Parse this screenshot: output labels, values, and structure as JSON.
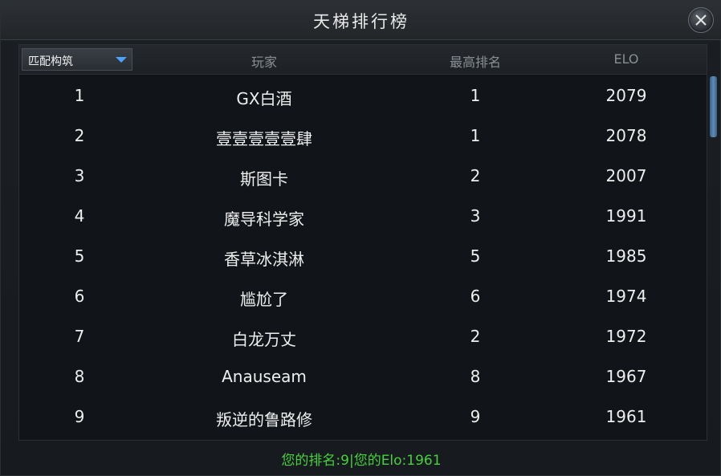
{
  "window": {
    "title": "天梯排行榜"
  },
  "filter": {
    "selected": "匹配构筑"
  },
  "columns": {
    "player": "玩家",
    "best_rank": "最高排名",
    "elo": "ELO"
  },
  "rows": [
    {
      "rank": "1",
      "player": "GX白酒",
      "best_rank": "1",
      "elo": "2079"
    },
    {
      "rank": "2",
      "player": "壹壹壹壹壹肆",
      "best_rank": "1",
      "elo": "2078"
    },
    {
      "rank": "3",
      "player": "斯图卡",
      "best_rank": "2",
      "elo": "2007"
    },
    {
      "rank": "4",
      "player": "魔导科学家",
      "best_rank": "3",
      "elo": "1991"
    },
    {
      "rank": "5",
      "player": "香草冰淇淋",
      "best_rank": "5",
      "elo": "1985"
    },
    {
      "rank": "6",
      "player": "尴尬了",
      "best_rank": "6",
      "elo": "1974"
    },
    {
      "rank": "7",
      "player": "白龙万丈",
      "best_rank": "2",
      "elo": "1972"
    },
    {
      "rank": "8",
      "player": "Anauseam",
      "best_rank": "8",
      "elo": "1967"
    },
    {
      "rank": "9",
      "player": "叛逆的鲁路修",
      "best_rank": "9",
      "elo": "1961"
    }
  ],
  "footer": {
    "my_stats": "您的排名:9|您的Elo:1961"
  },
  "colors": {
    "accent_green": "#44d13a",
    "dropdown_arrow": "#4aa3ff",
    "scrollbar": "#5b8dbb"
  }
}
